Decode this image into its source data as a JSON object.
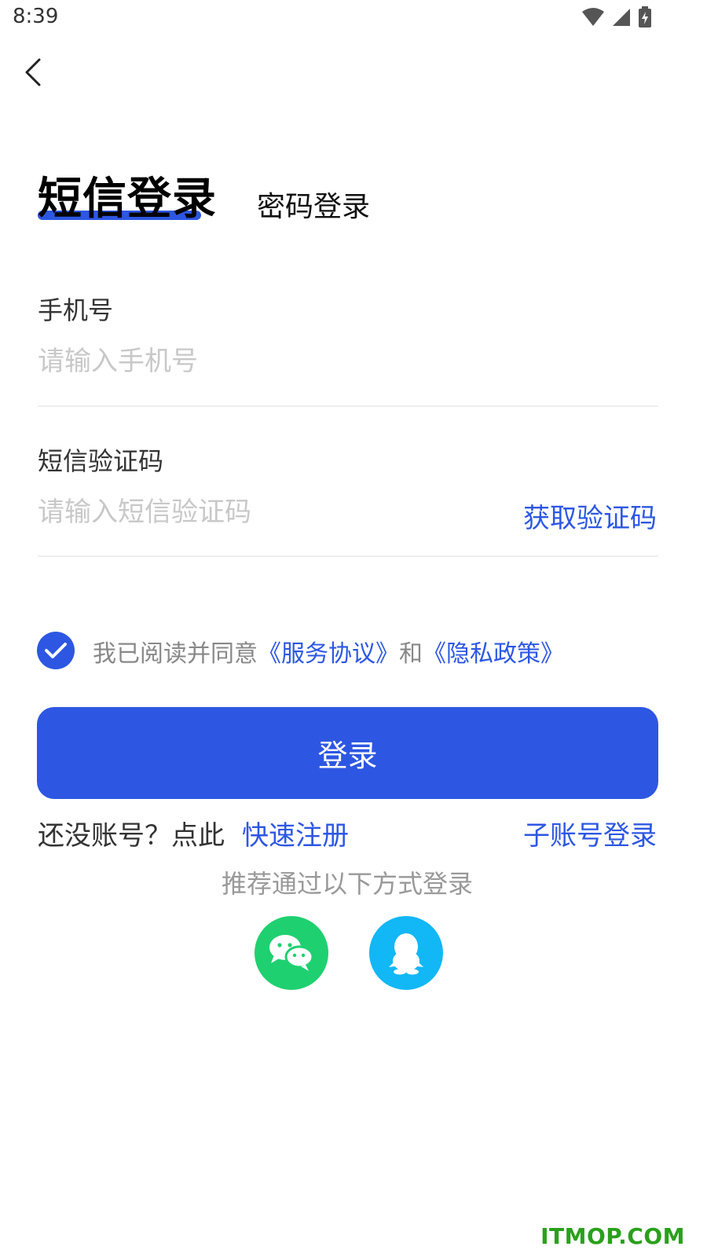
{
  "status_bar": {
    "time": "8:39",
    "icons": [
      "wifi-icon",
      "signal-icon",
      "battery-charging-icon"
    ]
  },
  "nav": {
    "back_icon": "chevron-left-icon"
  },
  "tabs": {
    "active_label": "短信登录",
    "inactive_label": "密码登录"
  },
  "form": {
    "phone_label": "手机号",
    "phone_placeholder": "请输入手机号",
    "phone_value": "",
    "sms_label": "短信验证码",
    "sms_placeholder": "请输入短信验证码",
    "sms_value": "",
    "get_code_label": "获取验证码"
  },
  "agreement": {
    "checked": true,
    "prefix": "我已阅读并同意",
    "service_link": "《服务协议》",
    "and": "和",
    "privacy_link": "《隐私政策》"
  },
  "login_button_label": "登录",
  "footer": {
    "no_account_text": "还没账号？点此",
    "register_link": "快速注册",
    "sub_account_link": "子账号登录",
    "recommend_text": "推荐通过以下方式登录",
    "social_icons": [
      "wechat-icon",
      "qq-icon"
    ]
  },
  "watermark": "ITMOP.COM",
  "colors": {
    "accent": "#2d57e2",
    "wechat": "#1fd070",
    "qq": "#12b7f5",
    "placeholder": "#c8c8c8",
    "watermark": "#2aa01c"
  }
}
